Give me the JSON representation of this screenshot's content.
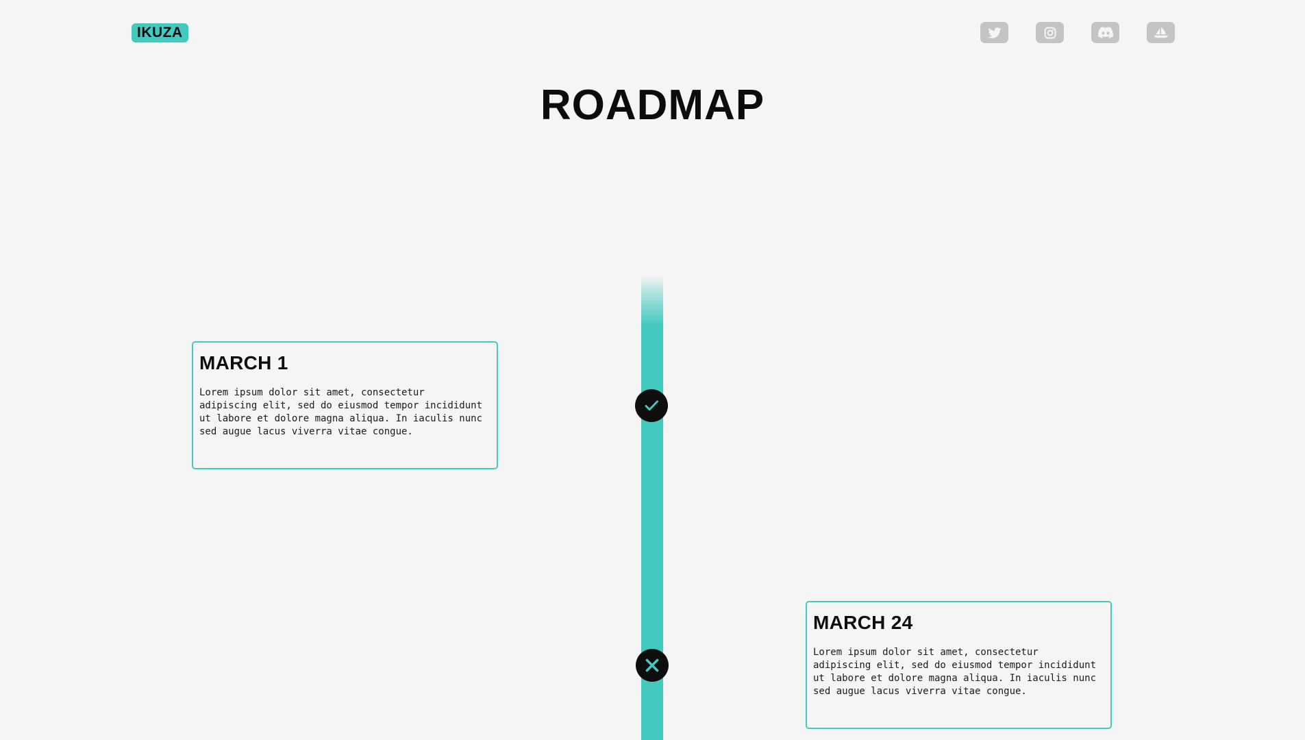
{
  "brand": {
    "logo": "IKUZA",
    "accent": "#43c9be"
  },
  "socials": [
    {
      "name": "twitter-icon"
    },
    {
      "name": "instagram-icon"
    },
    {
      "name": "discord-icon"
    },
    {
      "name": "opensea-icon"
    }
  ],
  "page": {
    "title": "ROADMAP"
  },
  "timeline": [
    {
      "date": "MARCH 1",
      "text": "Lorem ipsum dolor sit amet, consectetur adipiscing elit, sed do eiusmod tempor incididunt ut labore et dolore magna aliqua. In iaculis nunc sed augue lacus viverra vitae congue.",
      "status": "completed",
      "status_icon": "check-icon"
    },
    {
      "date": "MARCH 24",
      "text": "Lorem ipsum dolor sit amet, consectetur adipiscing elit, sed do eiusmod tempor incididunt ut labore et dolore magna aliqua. In iaculis nunc sed augue lacus viverra vitae congue.",
      "status": "not-completed",
      "status_icon": "close-icon"
    }
  ]
}
